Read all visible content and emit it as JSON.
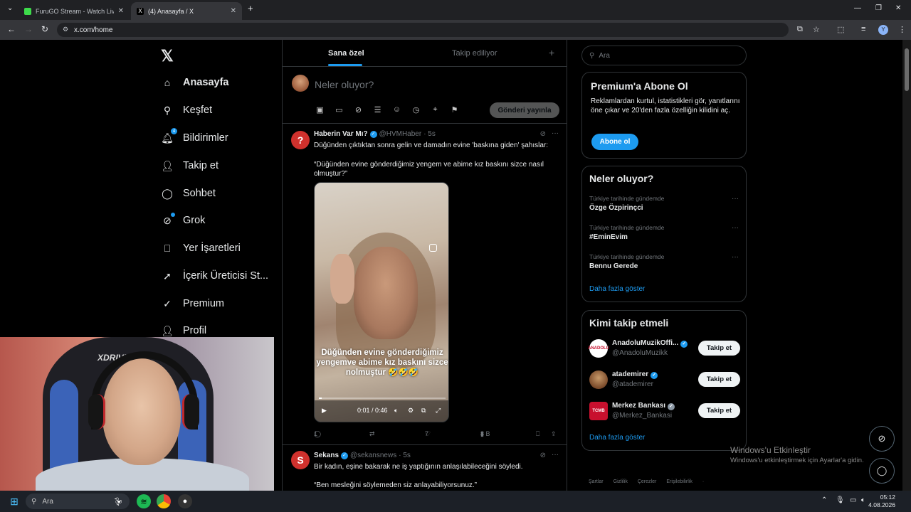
{
  "browser": {
    "tabs": [
      {
        "title": "FuruGO Stream - Watch Live o",
        "favicon_color": "#3ddc4b"
      },
      {
        "title": "(4) Anasayfa / X",
        "favicon_color": "#000000"
      }
    ],
    "url": "x.com/home",
    "profile_initial": "Y"
  },
  "sidebar": {
    "logo": "𝕏",
    "items": [
      {
        "label": "Anasayfa",
        "icon": "home-icon"
      },
      {
        "label": "Keşfet",
        "icon": "search-icon"
      },
      {
        "label": "Bildirimler",
        "icon": "bell-icon",
        "badge": "4"
      },
      {
        "label": "Takip et",
        "icon": "follow-icon"
      },
      {
        "label": "Sohbet",
        "icon": "chat-icon"
      },
      {
        "label": "Grok",
        "icon": "grok-icon"
      },
      {
        "label": "Yer İşaretleri",
        "icon": "bookmark-icon"
      },
      {
        "label": "İçerik Üreticisi St...",
        "icon": "rocket-icon"
      },
      {
        "label": "Premium",
        "icon": "premium-icon"
      },
      {
        "label": "Profil",
        "icon": "profile-icon"
      }
    ]
  },
  "timeline": {
    "tabs": [
      "Sana özel",
      "Takip ediliyor"
    ],
    "composer": {
      "placeholder": "Neler oluyor?",
      "post_button": "Gönderi yayınla"
    },
    "tweets": [
      {
        "name": "Haberin Var Mı?",
        "handle": "@HVMHaber",
        "time": "· 5s",
        "text1": "Düğünden çıktıktan sonra gelin ve damadın evine 'baskına giden' şahıslar:",
        "text2": "“Düğünden evine gönderdiğimiz yengem ve abime kız baskını sizce nasıl olmuştur?”",
        "avatar_color": "#d0312d",
        "avatar_letter": "?",
        "video": {
          "caption": "Düğünden evine gönderdiğimiz yengemve abime kız baskını sizce nolmuştur 🤣🤣🤣",
          "time": "0:01 / 0:46",
          "progress": 0.02
        },
        "stats": {
          "replies": "1",
          "likes": "7",
          "views": "8 B"
        }
      },
      {
        "name": "Sekans",
        "handle": "@sekansnews",
        "time": "· 5s",
        "text1": "Bir kadın, eşine bakarak ne iş yaptığının anlaşılabileceğini söyledi.",
        "text2": "“Ben mesleğini söylemeden siz anlayabiliyorsunuz.”",
        "avatar_color": "#d0312d",
        "avatar_letter": "S"
      }
    ]
  },
  "right": {
    "search_placeholder": "Ara",
    "premium": {
      "title": "Premium'a Abone Ol",
      "text": "Reklamlardan kurtul, istatistikleri gör, yanıtlarını öne çıkar ve 20'den fazla özelliğin kilidini aç.",
      "button": "Abone ol"
    },
    "trends": {
      "title": "Neler oluyor?",
      "items": [
        {
          "context": "Türkiye tarihinde gündemde",
          "name": "Özge Özpirinçci"
        },
        {
          "context": "Türkiye tarihinde gündemde",
          "name": "#EminEvim"
        },
        {
          "context": "Türkiye tarihinde gündemde",
          "name": "Bennu Gerede"
        }
      ],
      "show_more": "Daha fazla göster"
    },
    "who_to_follow": {
      "title": "Kimi takip etmeli",
      "items": [
        {
          "name": "AnadoluMuzikOffi...",
          "handle": "@AnadoluMuzikk",
          "avatar_color": "#ffffff",
          "avatar_text": "ANADOLU",
          "button": "Takip et"
        },
        {
          "name": "atademirer",
          "handle": "@atademirer",
          "avatar_color": "#7a4a2a",
          "avatar_text": "",
          "button": "Takip et"
        },
        {
          "name": "Merkez Bankası",
          "handle": "@Merkez_Bankasi",
          "avatar_color": "#c8102e",
          "avatar_text": "TCMB",
          "button": "Takip et"
        }
      ],
      "show_more": "Daha fazla göster"
    },
    "footer": [
      "Şartlar",
      "Gizlilik",
      "Çerezler",
      "Erişilebilirlik",
      "·"
    ]
  },
  "overlay": {
    "watermark_title": "Windows'u Etkinleştir",
    "watermark_sub": "Windows'u etkinleştirmek için Ayarlar'a gidin.",
    "webcam_brand": "XDRIVE"
  },
  "taskbar": {
    "search": "Ara",
    "time": "05:12",
    "date": "4.08.2026"
  }
}
